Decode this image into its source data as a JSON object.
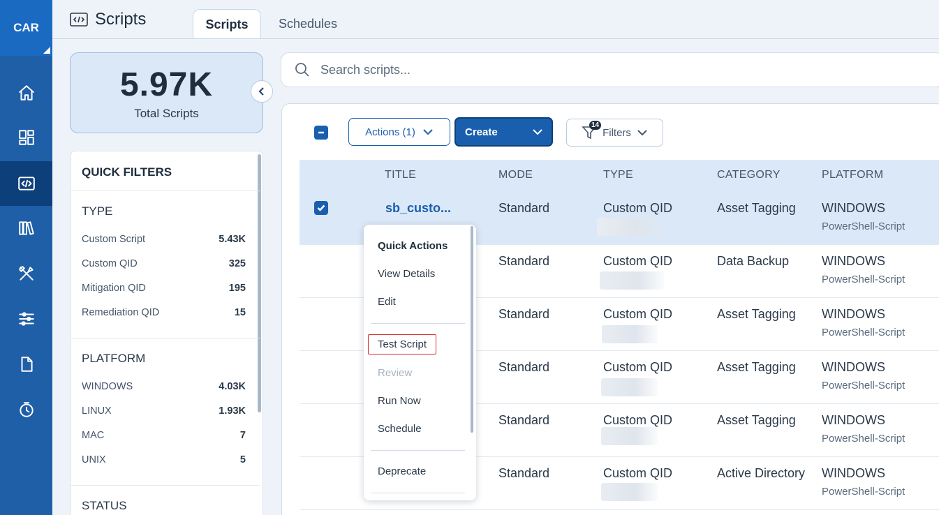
{
  "brand": "CAR",
  "nav": {
    "items": [
      {
        "icon": "home-icon"
      },
      {
        "icon": "dashboard-icon"
      },
      {
        "icon": "scripts-icon",
        "active": true
      },
      {
        "icon": "library-icon"
      },
      {
        "icon": "tools-icon"
      },
      {
        "icon": "sliders-icon"
      },
      {
        "icon": "document-icon"
      },
      {
        "icon": "clock-history-icon"
      }
    ]
  },
  "header": {
    "title": "Scripts",
    "tabs": [
      {
        "label": "Scripts",
        "active": true
      },
      {
        "label": "Schedules",
        "active": false
      }
    ]
  },
  "summary": {
    "total_value": "5.97K",
    "total_label": "Total Scripts"
  },
  "quick_filters": {
    "title": "QUICK FILTERS",
    "type": {
      "title": "TYPE",
      "items": [
        {
          "label": "Custom Script",
          "count": "5.43K"
        },
        {
          "label": "Custom QID",
          "count": "325"
        },
        {
          "label": "Mitigation QID",
          "count": "195"
        },
        {
          "label": "Remediation QID",
          "count": "15"
        }
      ]
    },
    "platform": {
      "title": "PLATFORM",
      "items": [
        {
          "label": "WINDOWS",
          "count": "4.03K"
        },
        {
          "label": "LINUX",
          "count": "1.93K"
        },
        {
          "label": "MAC",
          "count": "7"
        },
        {
          "label": "UNIX",
          "count": "5"
        }
      ]
    },
    "status": {
      "title": "STATUS"
    }
  },
  "search": {
    "placeholder": "Search scripts..."
  },
  "toolbar": {
    "actions_label": "Actions (1)",
    "create_label": "Create",
    "filters_label": "Filters",
    "filters_badge": "14"
  },
  "table": {
    "columns": [
      "TITLE",
      "MODE",
      "TYPE",
      "CATEGORY",
      "PLATFORM"
    ],
    "rows": [
      {
        "title": "sb_custo...",
        "mode": "Standard",
        "type": "Custom QID",
        "category": "Asset Tagging",
        "platform": "WINDOWS",
        "platform_sub": "PowerShell-Script",
        "selected": true
      },
      {
        "title": "",
        "mode": "Standard",
        "type": "Custom QID",
        "category": "Data Backup",
        "platform": "WINDOWS",
        "platform_sub": "PowerShell-Script"
      },
      {
        "title": "",
        "mode": "Standard",
        "type": "Custom QID",
        "category": "Asset Tagging",
        "platform": "WINDOWS",
        "platform_sub": "PowerShell-Script"
      },
      {
        "title": "",
        "mode": "Standard",
        "type": "Custom QID",
        "category": "Asset Tagging",
        "platform": "WINDOWS",
        "platform_sub": "PowerShell-Script"
      },
      {
        "title": "",
        "mode": "Standard",
        "type": "Custom QID",
        "category": "Asset Tagging",
        "platform": "WINDOWS",
        "platform_sub": "PowerShell-Script"
      },
      {
        "title": "",
        "mode": "Standard",
        "type": "Custom QID",
        "category": "Active Directory",
        "platform": "WINDOWS",
        "platform_sub": "PowerShell-Script"
      }
    ]
  },
  "context_menu": {
    "header": "Quick Actions",
    "view_details": "View Details",
    "edit": "Edit",
    "test_script": "Test Script",
    "review": "Review",
    "run_now": "Run Now",
    "schedule": "Schedule",
    "deprecate": "Deprecate"
  },
  "colors": {
    "rail": "#1f5fa8",
    "accent": "#1a5fae",
    "highlight_border": "#d32f2f",
    "selected_row": "#dbe8f7"
  }
}
